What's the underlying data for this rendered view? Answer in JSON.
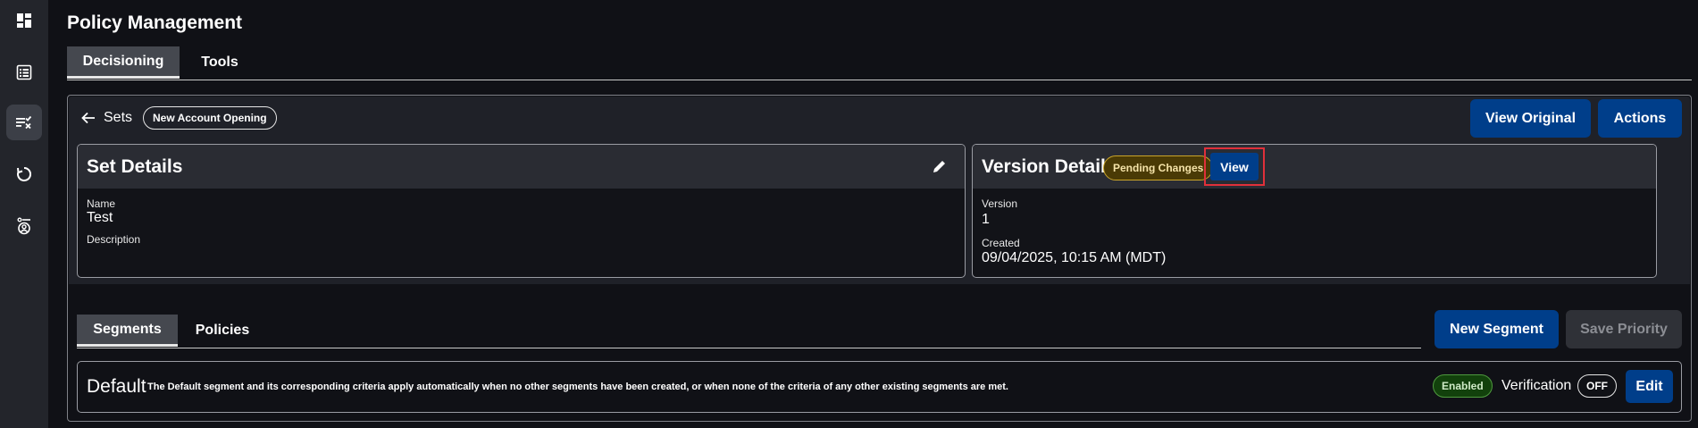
{
  "sidebar": {
    "items": [
      {
        "icon": "dashboard-icon"
      },
      {
        "icon": "list-icon"
      },
      {
        "icon": "policy-rules-icon",
        "active": true
      },
      {
        "icon": "refresh-icon"
      },
      {
        "icon": "user-settings-icon"
      }
    ]
  },
  "header": {
    "title": "Policy Management"
  },
  "top_tabs": [
    {
      "label": "Decisioning",
      "active": true
    },
    {
      "label": "Tools",
      "active": false
    }
  ],
  "breadcrumb": {
    "back_label": "Sets",
    "chip": "New Account Opening"
  },
  "toolbar": {
    "view_original": "View Original",
    "actions": "Actions"
  },
  "set_details": {
    "title": "Set Details",
    "name_label": "Name",
    "name_value": "Test",
    "description_label": "Description",
    "description_value": ""
  },
  "version_details": {
    "title": "Version Details",
    "status_chip": "Pending Changes",
    "view_label": "View",
    "version_label": "Version",
    "version_value": "1",
    "created_label": "Created",
    "created_value": "09/04/2025, 10:15 AM (MDT)"
  },
  "segment_tabs": [
    {
      "label": "Segments",
      "active": true
    },
    {
      "label": "Policies",
      "active": false
    }
  ],
  "segment_actions": {
    "new_segment": "New Segment",
    "save_priority": "Save Priority"
  },
  "default_segment": {
    "title": "Default",
    "description": "The Default segment and its corresponding criteria apply automatically when no other segments have been created, or when none of the criteria of any other existing segments are met.",
    "status": "Enabled",
    "verification_label": "Verification",
    "verification_state": "OFF",
    "edit_label": "Edit"
  },
  "colors": {
    "background": "#101116",
    "primary_button": "#003e8a",
    "pending": "#4a3a05",
    "enabled": "#12410c",
    "highlight": "#e0303a"
  }
}
